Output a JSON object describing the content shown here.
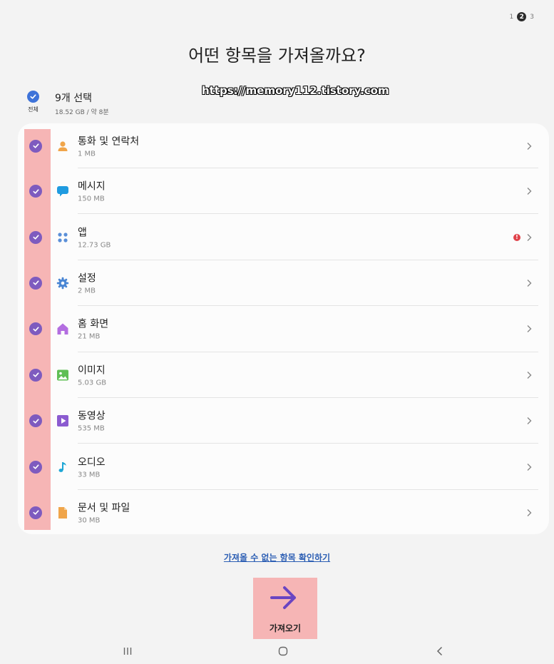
{
  "steps": {
    "first": "1",
    "current": "2",
    "last": "3"
  },
  "title": "어떤 항목을 가져올까요?",
  "watermark": "https://memory112.tistory.com",
  "select_all": {
    "label": "전체",
    "count": "9개 선택",
    "size": "18.52 GB / 약 8분"
  },
  "items": [
    {
      "title": "통화 및 연락처",
      "size": "1 MB",
      "icon": "contact-person-icon"
    },
    {
      "title": "메시지",
      "size": "150 MB",
      "icon": "message-bubble-icon"
    },
    {
      "title": "앱",
      "size": "12.73 GB",
      "icon": "apps-grid-icon",
      "warning": "!"
    },
    {
      "title": "설정",
      "size": "2 MB",
      "icon": "settings-gear-icon"
    },
    {
      "title": "홈 화면",
      "size": "21 MB",
      "icon": "home-icon"
    },
    {
      "title": "이미지",
      "size": "5.03 GB",
      "icon": "image-icon"
    },
    {
      "title": "동영상",
      "size": "535 MB",
      "icon": "video-play-icon"
    },
    {
      "title": "오디오",
      "size": "33 MB",
      "icon": "music-note-icon"
    },
    {
      "title": "문서 및 파일",
      "size": "30 MB",
      "icon": "document-icon"
    }
  ],
  "link_text": "가져올 수 없는 항목 확인하기",
  "import_button": "가져오기",
  "colors": {
    "accent": "#7e5bbf",
    "select_all": "#3e73d9",
    "highlight": "#f6b5b5",
    "link": "#2d5fb4"
  }
}
